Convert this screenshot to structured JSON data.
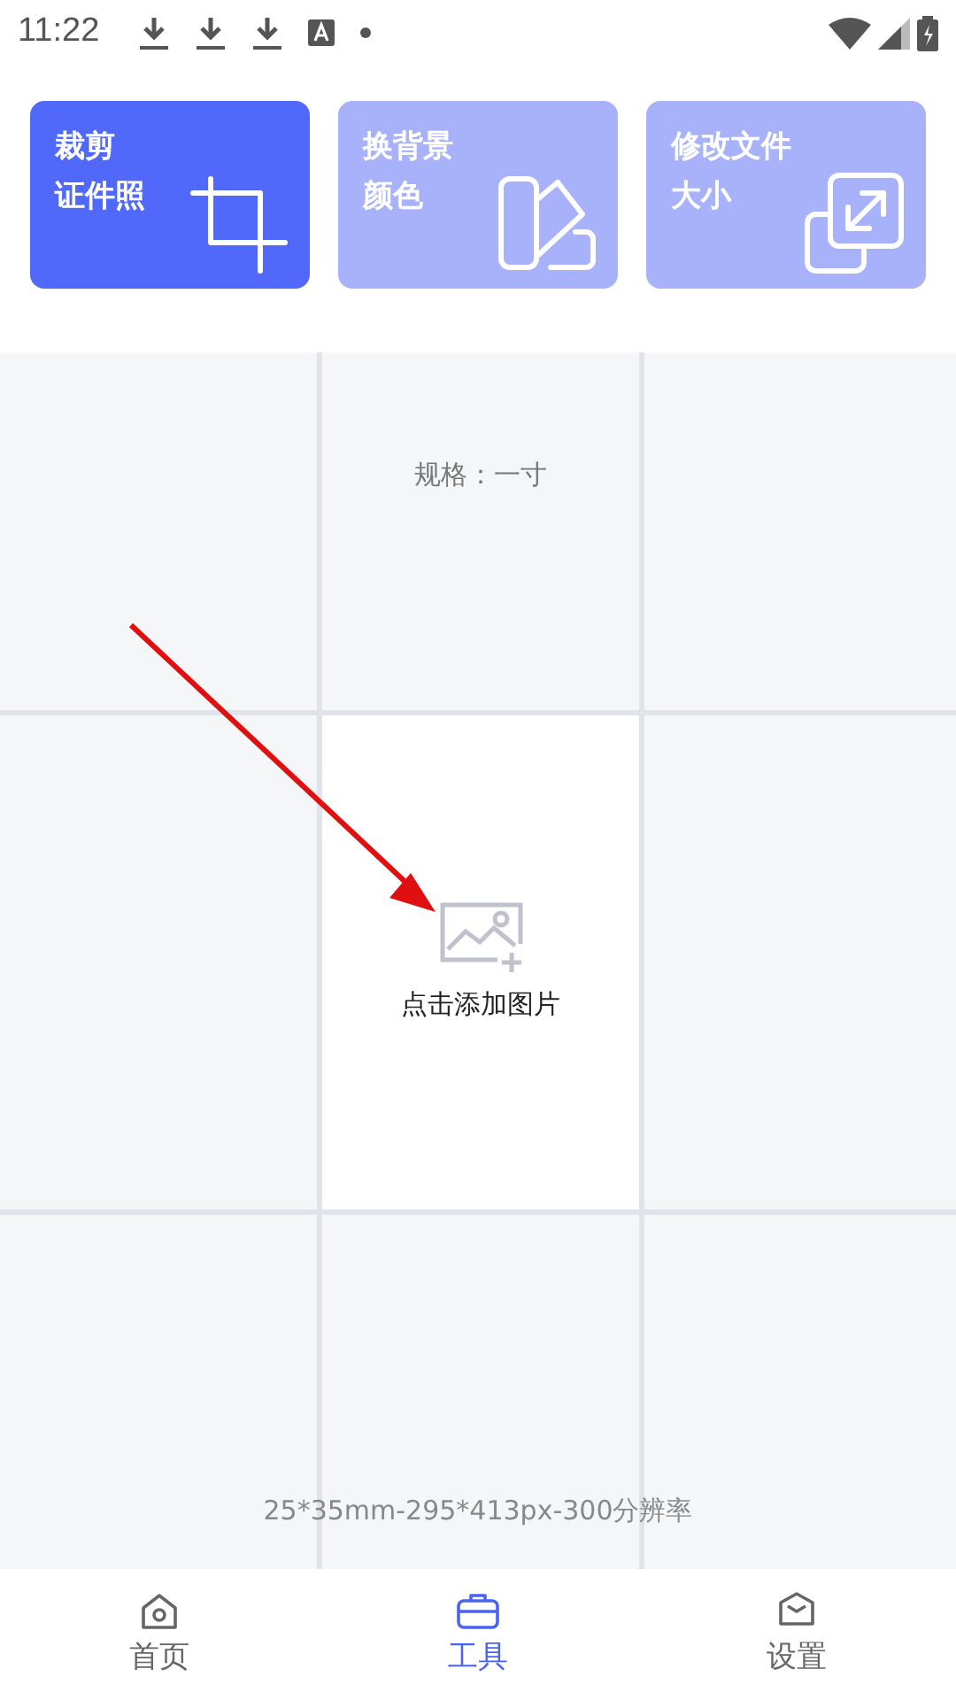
{
  "status_bar": {
    "time": "11:22"
  },
  "tools": [
    {
      "kind": "crop",
      "line1": "裁剪",
      "line2": "证件照",
      "selected": true
    },
    {
      "kind": "palette",
      "line1": "换背景",
      "line2": "颜色",
      "selected": false
    },
    {
      "kind": "resize",
      "line1": "修改文件",
      "line2": "大小",
      "selected": false
    }
  ],
  "canvas": {
    "spec": "规格：一寸",
    "add_label": "点击添加图片",
    "size_info": "25*35mm-295*413px-300分辨率"
  },
  "nav": [
    {
      "kind": "home",
      "label": "首页",
      "selected": false
    },
    {
      "kind": "tools",
      "label": "工具",
      "selected": true
    },
    {
      "kind": "settings",
      "label": "设置",
      "selected": false
    }
  ]
}
